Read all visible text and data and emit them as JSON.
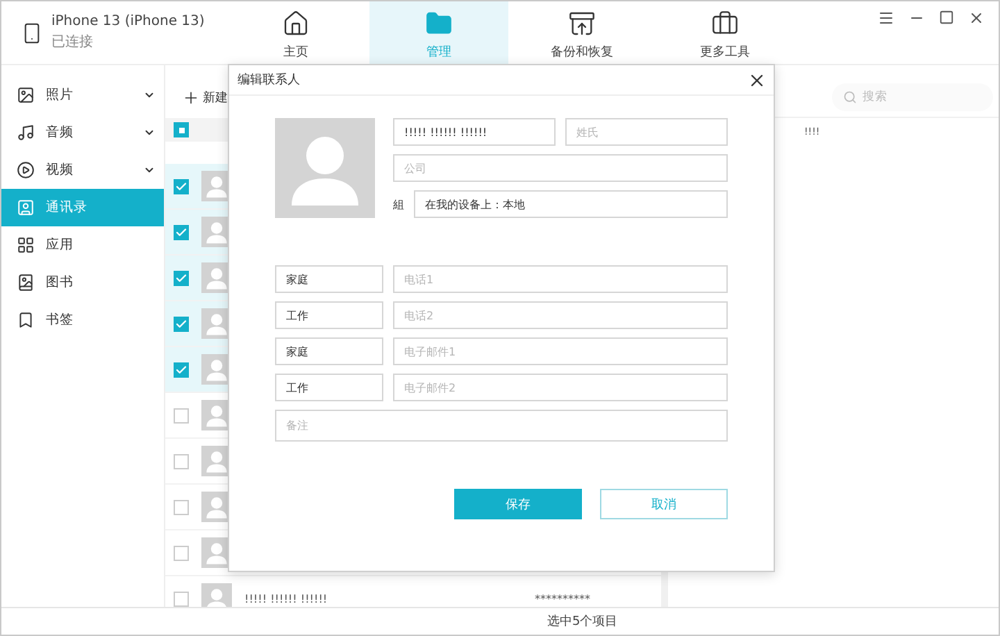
{
  "device": {
    "name": "iPhone 13 (iPhone 13)",
    "status": "已连接"
  },
  "tabs": [
    {
      "label": "主页",
      "selected": false
    },
    {
      "label": "管理",
      "selected": true
    },
    {
      "label": "备份和恢复",
      "selected": false
    },
    {
      "label": "更多工具",
      "selected": false
    }
  ],
  "sidebar": {
    "items": [
      {
        "label": "照片",
        "expandable": true,
        "selected": false
      },
      {
        "label": "音频",
        "expandable": true,
        "selected": false
      },
      {
        "label": "视频",
        "expandable": true,
        "selected": false
      },
      {
        "label": "通讯录",
        "expandable": false,
        "selected": true
      },
      {
        "label": "应用",
        "expandable": false,
        "selected": false
      },
      {
        "label": "图书",
        "expandable": false,
        "selected": false
      },
      {
        "label": "书签",
        "expandable": false,
        "selected": false
      }
    ]
  },
  "contacts": {
    "new_button": "新建",
    "select_all": {
      "indeterminate": true
    },
    "rows": [
      {
        "checked": true
      },
      {
        "checked": true
      },
      {
        "checked": true
      },
      {
        "checked": true
      },
      {
        "checked": true
      },
      {
        "checked": false
      },
      {
        "checked": false
      },
      {
        "checked": false
      },
      {
        "checked": false
      },
      {
        "checked": false,
        "name": "!!!!! !!!!!! !!!!!!",
        "phone": "**********"
      }
    ]
  },
  "search": {
    "placeholder": "搜索"
  },
  "detail": {
    "text": "!!!!"
  },
  "dialog": {
    "title": "编辑联系人",
    "given_name": {
      "value": "!!!!! !!!!!! !!!!!!"
    },
    "family_name": {
      "placeholder": "姓氏"
    },
    "company": {
      "placeholder": "公司"
    },
    "group": {
      "label": "組",
      "value": "在我的设备上：本地"
    },
    "entries": [
      {
        "type": "家庭",
        "placeholder": "电话1"
      },
      {
        "type": "工作",
        "placeholder": "电话2"
      },
      {
        "type": "家庭",
        "placeholder": "电子邮件1"
      },
      {
        "type": "工作",
        "placeholder": "电子邮件2"
      }
    ],
    "notes": {
      "placeholder": "备注"
    },
    "buttons": [
      {
        "label": "保存",
        "kind": "primary"
      },
      {
        "label": "取消",
        "kind": "secondary"
      }
    ]
  },
  "status_bar": "选中5个项目"
}
